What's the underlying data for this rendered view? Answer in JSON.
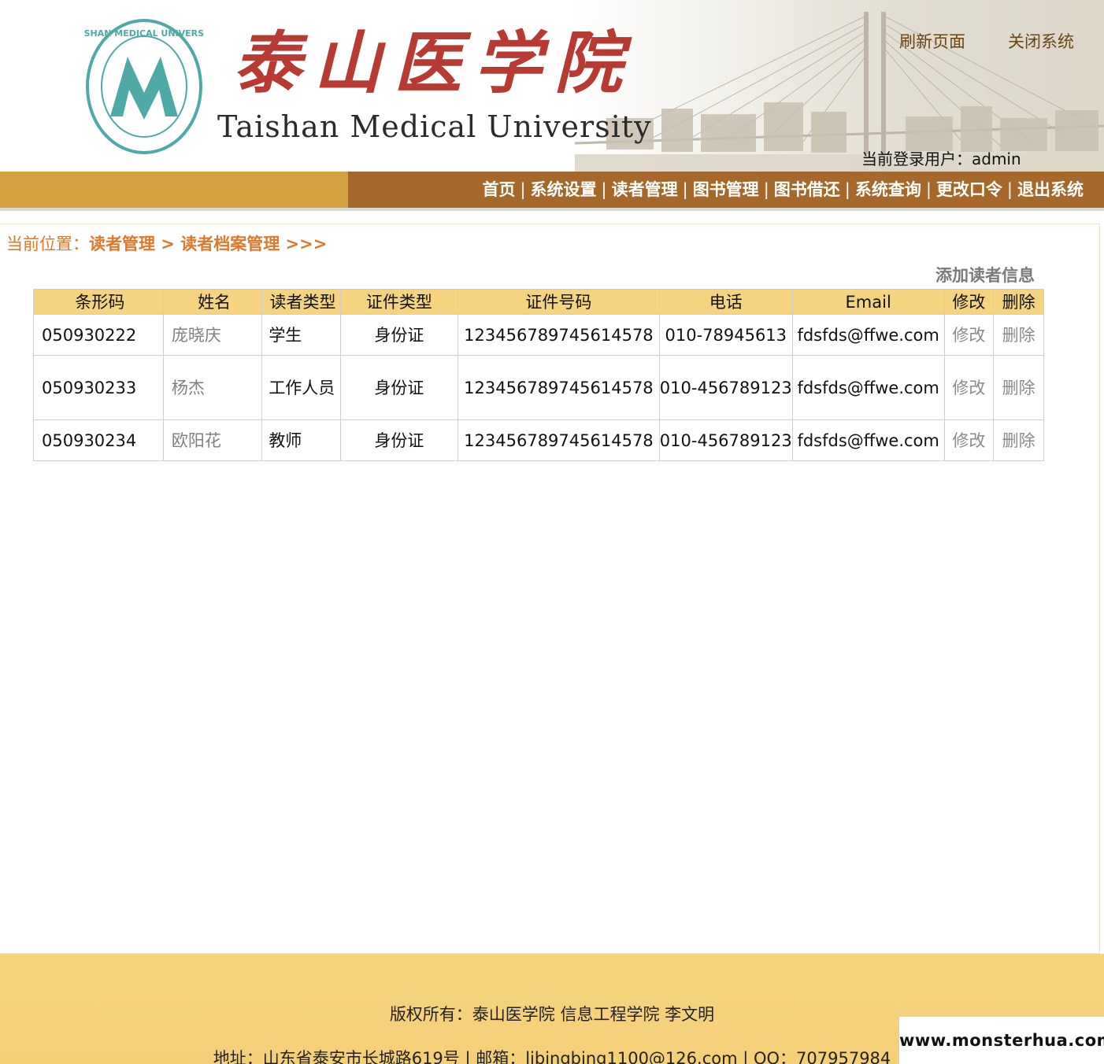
{
  "header": {
    "school_name_cn": "泰山医学院",
    "school_name_en": "Taishan Medical University",
    "seal_text": "TAISHAN MEDICAL UNIVERSITY",
    "refresh_label": "刷新页面",
    "close_label": "关闭系统",
    "login_label": "当前登录用户：",
    "login_user": "admin"
  },
  "nav": {
    "items": [
      "首页",
      "系统设置",
      "读者管理",
      "图书管理",
      "图书借还",
      "系统查询",
      "更改口令",
      "退出系统"
    ],
    "separator": "|"
  },
  "breadcrumb": {
    "prefix": "当前位置：",
    "path": "读者管理 > 读者档案管理 >>>"
  },
  "add_link": "添加读者信息",
  "table": {
    "headers": [
      "条形码",
      "姓名",
      "读者类型",
      "证件类型",
      "证件号码",
      "电话",
      "Email",
      "修改",
      "删除"
    ],
    "rows": [
      {
        "barcode": "050930222",
        "name": "庞晓庆",
        "type": "学生",
        "id_type": "身份证",
        "id_number": "123456789745614578",
        "phone": "010-78945613",
        "email": "fdsfds@ffwe.com",
        "edit": "修改",
        "delete": "删除"
      },
      {
        "barcode": "050930233",
        "name": "杨杰",
        "type": "工作人员",
        "id_type": "身份证",
        "id_number": "123456789745614578",
        "phone": "010-456789123",
        "email": "fdsfds@ffwe.com",
        "edit": "修改",
        "delete": "删除"
      },
      {
        "barcode": "050930234",
        "name": "欧阳花",
        "type": "教师",
        "id_type": "身份证",
        "id_number": "123456789745614578",
        "phone": "010-456789123",
        "email": "fdsfds@ffwe.com",
        "edit": "修改",
        "delete": "删除"
      }
    ]
  },
  "footer": {
    "copyright": "版权所有：泰山医学院 信息工程学院 李文明",
    "address": "地址：山东省泰安市长城路619号 | 邮箱：libingbing1100@126.com | QQ：707957984"
  },
  "watermark": "www.monsterhua.com",
  "colors": {
    "accent_orange": "#e0782a",
    "nav_brown": "#a6682a",
    "nav_gold": "#d3a23e",
    "table_header": "#f6d37f",
    "footer": "#f4d07a",
    "logo_red": "#b73a33",
    "seal_teal": "#4fa9a7"
  }
}
